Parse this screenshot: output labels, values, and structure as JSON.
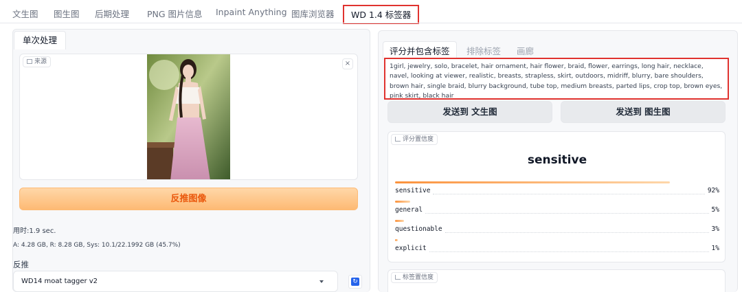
{
  "top_tabs": [
    {
      "label": "文生图"
    },
    {
      "label": "图生图"
    },
    {
      "label": "后期处理"
    },
    {
      "label": "PNG 图片信息"
    },
    {
      "label": "Inpaint Anything"
    },
    {
      "label": "图库浏览器"
    },
    {
      "label": "WD 1.4 标签器",
      "active": true
    }
  ],
  "left": {
    "sub_tab": "单次处理",
    "image_label": "来源",
    "image_icon": "image-icon",
    "close_icon": "close-icon",
    "close_glyph": "×",
    "interrogate_button": "反推图像",
    "time_text": "用时:1.9 sec.",
    "mem_text": "A: 4.28 GB, R: 8.28 GB, Sys: 10.1/22.1992 GB (45.7%)",
    "interrogator_label": "反推",
    "model_value": "WD14 moat tagger v2",
    "refresh_icon": "refresh-icon"
  },
  "right": {
    "tabs": [
      {
        "label": "评分并包含标签",
        "active": true
      },
      {
        "label": "排除标签"
      },
      {
        "label": "画廊"
      }
    ],
    "tags_text": "1girl, jewelry, solo, bracelet, hair ornament, hair flower, braid, flower, earrings, long hair, necklace, navel, looking at viewer, realistic, breasts, strapless, skirt, outdoors, midriff, blurry, bare shoulders, brown hair, single braid, blurry background, tube top, medium breasts, parted lips, crop top, brown eyes, pink skirt, black hair",
    "send_txt2img": "发送到 文生图",
    "send_img2img": "发送到 图生图",
    "rating_label": "评分置信度",
    "rating_top": "sensitive",
    "ratings": [
      {
        "name": "sensitive",
        "value": 0.92,
        "display": "92%"
      },
      {
        "name": "general",
        "value": 0.05,
        "display": "5%"
      },
      {
        "name": "questionable",
        "value": 0.03,
        "display": "3%"
      },
      {
        "name": "explicit",
        "value": 0.01,
        "display": "1%"
      }
    ],
    "tag_conf_label": "标签置信度",
    "chart_icon": "chart-icon"
  },
  "colors": {
    "accent_orange": "#ea580c",
    "highlight_red": "#e0322e"
  }
}
